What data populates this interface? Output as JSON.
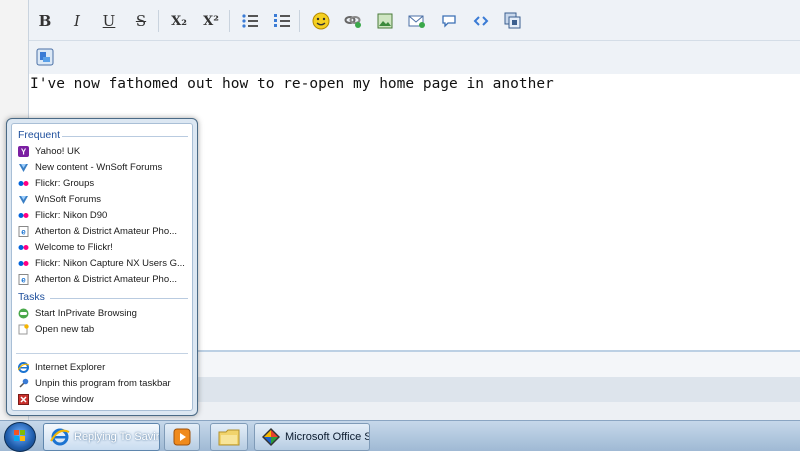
{
  "editor": {
    "text": "I've now fathomed out how to re-open my home page in another"
  },
  "toolbar": {
    "bold": "B",
    "italic": "I",
    "underline": "U",
    "strike": "S",
    "subscript": "X₂",
    "superscript": "X²"
  },
  "jumplist": {
    "frequent_header": "Frequent",
    "frequent": [
      {
        "label": "Yahoo! UK",
        "icon": "yahoo-icon"
      },
      {
        "label": "New content - WnSoft Forums",
        "icon": "wnsoft-icon"
      },
      {
        "label": "Flickr: Groups",
        "icon": "flickr-icon"
      },
      {
        "label": "WnSoft Forums",
        "icon": "wnsoft-icon"
      },
      {
        "label": "Flickr: Nikon D90",
        "icon": "flickr-icon"
      },
      {
        "label": "Atherton & District Amateur Pho...",
        "icon": "ie-page-icon"
      },
      {
        "label": "Welcome to Flickr!",
        "icon": "flickr-icon"
      },
      {
        "label": "Flickr: Nikon Capture NX Users G...",
        "icon": "flickr-icon"
      },
      {
        "label": "Atherton & District Amateur Pho...",
        "icon": "ie-page-icon"
      }
    ],
    "tasks_header": "Tasks",
    "tasks": [
      {
        "label": "Start InPrivate Browsing",
        "icon": "inprivate-icon"
      },
      {
        "label": "Open new tab",
        "icon": "new-tab-icon"
      }
    ],
    "app": [
      {
        "label": "Internet Explorer",
        "icon": "ie-icon"
      },
      {
        "label": "Unpin this program from taskbar",
        "icon": "unpin-icon"
      },
      {
        "label": "Close window",
        "icon": "close-window-icon"
      }
    ]
  },
  "taskbar": {
    "ie_window": "Replying To Savin...",
    "office_window": "Microsoft Office S..."
  }
}
